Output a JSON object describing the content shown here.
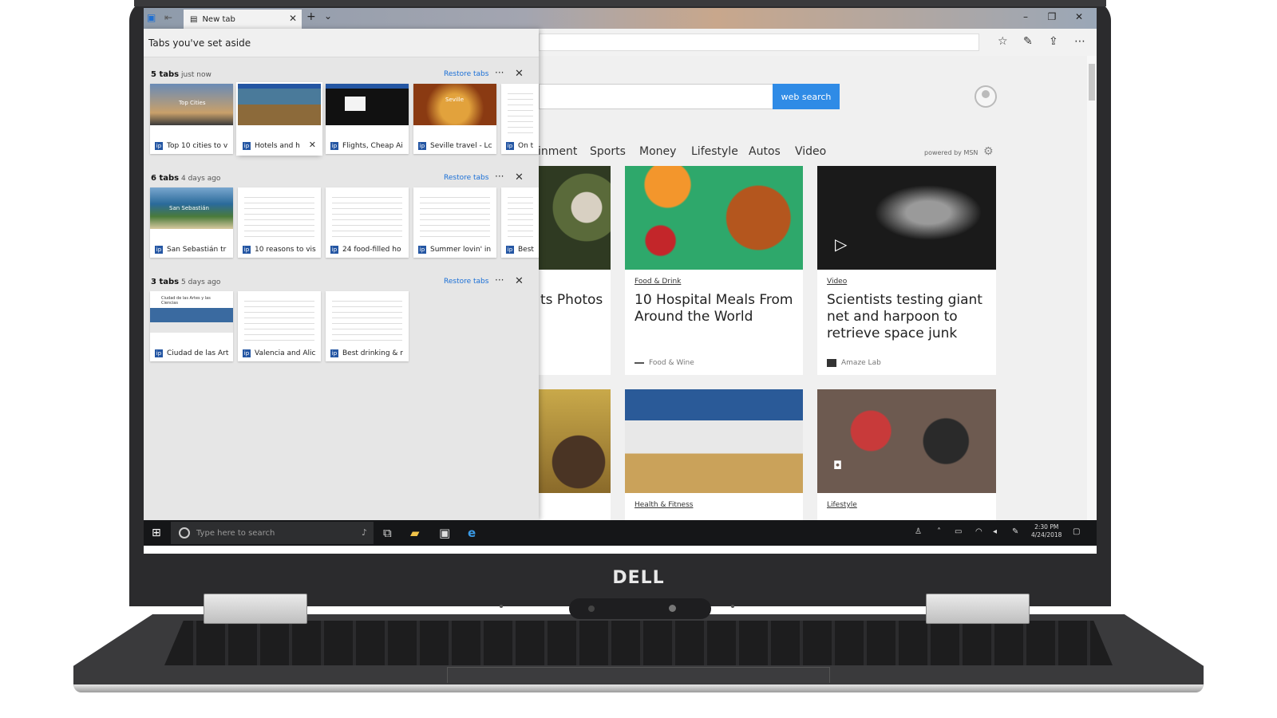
{
  "browser": {
    "tab_title": "New tab",
    "tab_close": "✕",
    "new_tab": "+",
    "tab_menu": "⌄",
    "window_controls": {
      "minimize": "–",
      "restore": "❐",
      "close": "✕"
    },
    "toolbar_icons": [
      "star-icon",
      "pen-icon",
      "share-icon",
      "more-icon"
    ]
  },
  "page": {
    "search_button": "web search",
    "nav": [
      "inment",
      "Sports",
      "Money",
      "Lifestyle",
      "Autos",
      "Video"
    ],
    "powered_by": "powered by MSN",
    "cards": [
      {
        "category": "",
        "title": "ts Photos",
        "source": ""
      },
      {
        "category": "Food & Drink",
        "title": "10 Hospital Meals From Around the World",
        "source": "Food & Wine"
      },
      {
        "category": "Video",
        "title": "Scientists testing giant net and harpoon to retrieve space junk",
        "source": "Amaze Lab"
      },
      {
        "category": "",
        "title": "",
        "source": ""
      },
      {
        "category": "Health & Fitness",
        "title": "",
        "source": ""
      },
      {
        "category": "Lifestyle",
        "title": "",
        "source": ""
      }
    ]
  },
  "panel": {
    "title": "Tabs you've set aside",
    "restore_label": "Restore tabs",
    "more": "···",
    "close": "✕",
    "groups": [
      {
        "count": "5 tabs",
        "time": "just now",
        "tabs": [
          {
            "label": "Top 10 cities to v",
            "thumb_text": "Top Cities"
          },
          {
            "label": "Hotels and h",
            "thumb_text": ""
          },
          {
            "label": "Flights, Cheap Ai",
            "thumb_text": ""
          },
          {
            "label": "Seville travel - Lc",
            "thumb_text": "Seville"
          },
          {
            "label": "On t",
            "thumb_text": ""
          }
        ]
      },
      {
        "count": "6 tabs",
        "time": "4 days ago",
        "tabs": [
          {
            "label": "San Sebastián tr",
            "thumb_text": "San Sebastián"
          },
          {
            "label": "10 reasons to vis",
            "thumb_text": ""
          },
          {
            "label": "24 food-filled ho",
            "thumb_text": ""
          },
          {
            "label": "Summer lovin' in",
            "thumb_text": ""
          },
          {
            "label": "Best",
            "thumb_text": ""
          }
        ]
      },
      {
        "count": "3 tabs",
        "time": "5 days ago",
        "tabs": [
          {
            "label": "Ciudad de las Art",
            "thumb_text": "Ciudad de las Artes y las Ciencias"
          },
          {
            "label": "Valencia and Alic",
            "thumb_text": ""
          },
          {
            "label": "Best drinking & r",
            "thumb_text": ""
          }
        ]
      }
    ]
  },
  "taskbar": {
    "search_placeholder": "Type here to search",
    "time": "2:30 PM",
    "date": "4/24/2018"
  },
  "laptop": {
    "brand": "DELL"
  }
}
